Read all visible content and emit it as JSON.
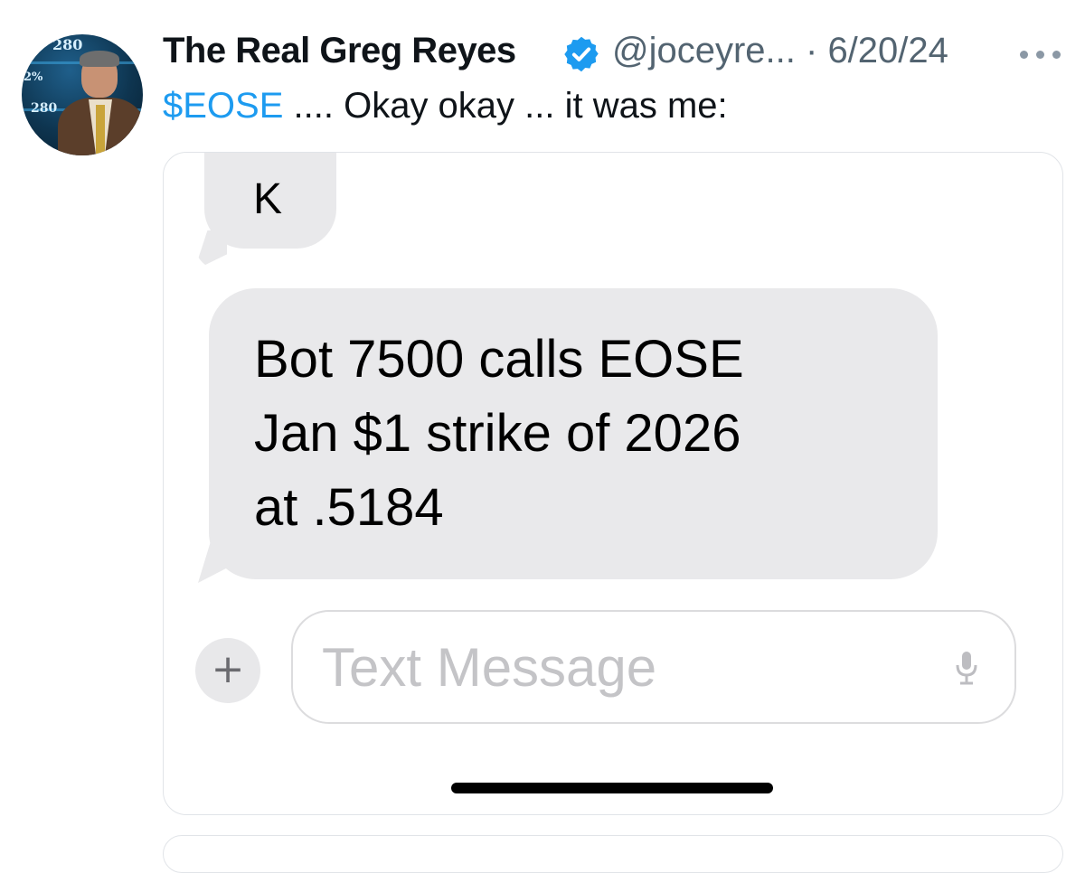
{
  "tweet": {
    "author_name": "The Real Greg Reyes",
    "handle_date": "@joceyre... · 6/20/24",
    "text_cashtag": "$EOSE",
    "text_rest": " .... Okay okay ... it was me:",
    "verified_color": "#1d9bf0",
    "avatar_ticker_1": "280",
    "avatar_ticker_2": "2%",
    "avatar_ticker_3": "280"
  },
  "screenshot": {
    "messages": [
      {
        "text": "K"
      },
      {
        "lines": [
          "Bot 7500 calls EOSE",
          "Jan $1 strike of 2026",
          "at .5184"
        ]
      }
    ],
    "compose_placeholder": "Text Message",
    "plus_label": "+"
  }
}
